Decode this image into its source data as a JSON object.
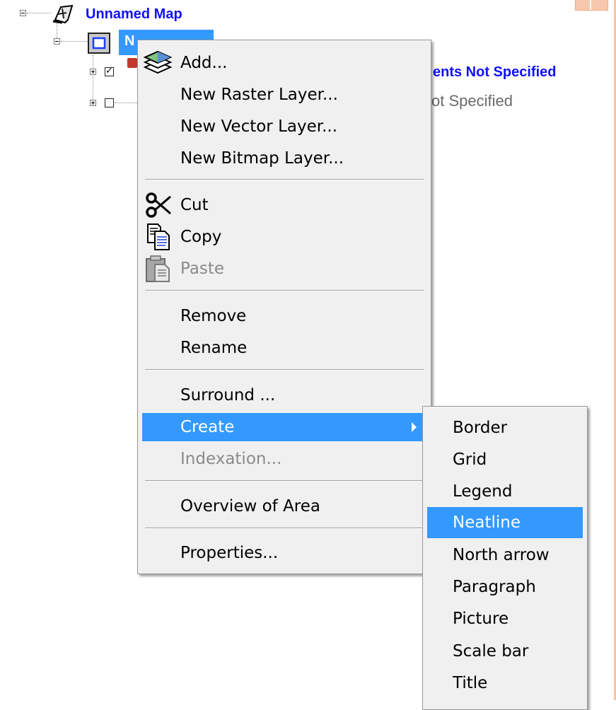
{
  "tree": {
    "root_label": "Unnamed Map",
    "selected_node_label": "N",
    "row1_label": "ents Not Specified",
    "row2_label": "ot Specified"
  },
  "context_menu": {
    "add": "Add...",
    "new_raster": "New Raster Layer...",
    "new_vector": "New Vector Layer...",
    "new_bitmap": "New Bitmap Layer...",
    "cut": "Cut",
    "copy": "Copy",
    "paste": "Paste",
    "remove": "Remove",
    "rename": "Rename",
    "surround": "Surround ...",
    "create": "Create",
    "indexation": "Indexation...",
    "overview": "Overview of Area",
    "properties": "Properties..."
  },
  "create_submenu": {
    "items": [
      "Border",
      "Grid",
      "Legend",
      "Neatline",
      "North arrow",
      "Paragraph",
      "Picture",
      "Scale bar",
      "Title"
    ],
    "highlighted": "Neatline"
  },
  "colors": {
    "highlight": "#3399ff",
    "menu_bg": "#f0f0f0",
    "tree_link": "#1010ff"
  }
}
